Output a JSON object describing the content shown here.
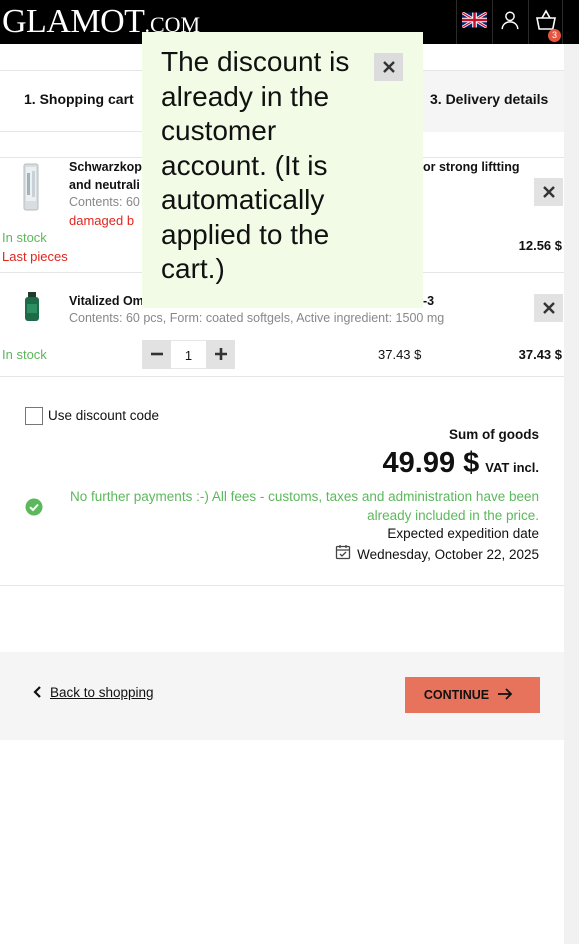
{
  "header": {
    "logo_main": "GLAMOT",
    "logo_suffix": ".COM",
    "cart_count": "3",
    "icons": [
      "uk-flag-icon",
      "user-icon",
      "basket-icon"
    ]
  },
  "steps": {
    "step1": "1. Shopping cart",
    "step3": "3. Delivery details"
  },
  "items": [
    {
      "name_start": "Schwarzkop",
      "name_end": "or strong liftting",
      "name_line2": "and neutrali",
      "contents": "Contents: 60",
      "damaged": "damaged b",
      "stock": "In stock",
      "last_pieces": "Last pieces",
      "total": "12.56 $"
    },
    {
      "name_start": "Vitalized Om",
      "name_end": "-3",
      "contents": "Contents: 60 pcs, Form: coated softgels, Active ingredient: 1500 mg",
      "stock": "In stock",
      "quantity": "1",
      "unit_price": "37.43 $",
      "total": "37.43 $"
    }
  ],
  "summary": {
    "discount_label": "Use discount code",
    "sum_label": "Sum of goods",
    "sum_value": "49.99 $",
    "vat_label": "VAT incl.",
    "fees_note": "No further payments :-) All fees - customs, taxes and administration have been already included in the price.",
    "expedition_label": "Expected expedition date",
    "expedition_date": "Wednesday, October 22, 2025"
  },
  "footer": {
    "back_label": "Back to shopping",
    "continue_label": "CONTINUE"
  },
  "tooltip": {
    "text": "The discount is already in the customer account. (It is automatically applied to the cart.)"
  },
  "colors": {
    "header_bg": "#000000",
    "accent_button": "#e8735d",
    "badge": "#e8553f",
    "stock_green": "#5cb85c",
    "warning_red": "#e0261f",
    "tooltip_bg": "#f1fbe5"
  }
}
